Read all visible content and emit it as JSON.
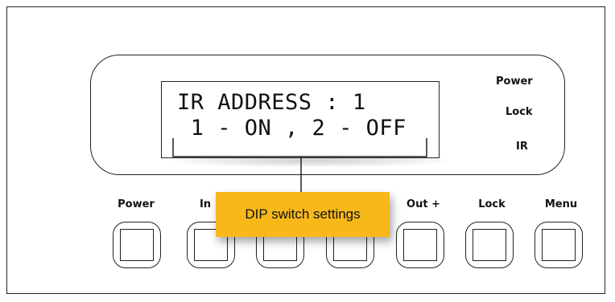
{
  "lcd": {
    "line1": "IR ADDRESS : 1",
    "line2": " 1 - ON , 2 - OFF"
  },
  "indicators": [
    "Power",
    "Lock",
    "IR"
  ],
  "buttons": [
    "Power",
    "In",
    "Out +",
    "Lock",
    "Menu"
  ],
  "callout": "DIP switch settings"
}
